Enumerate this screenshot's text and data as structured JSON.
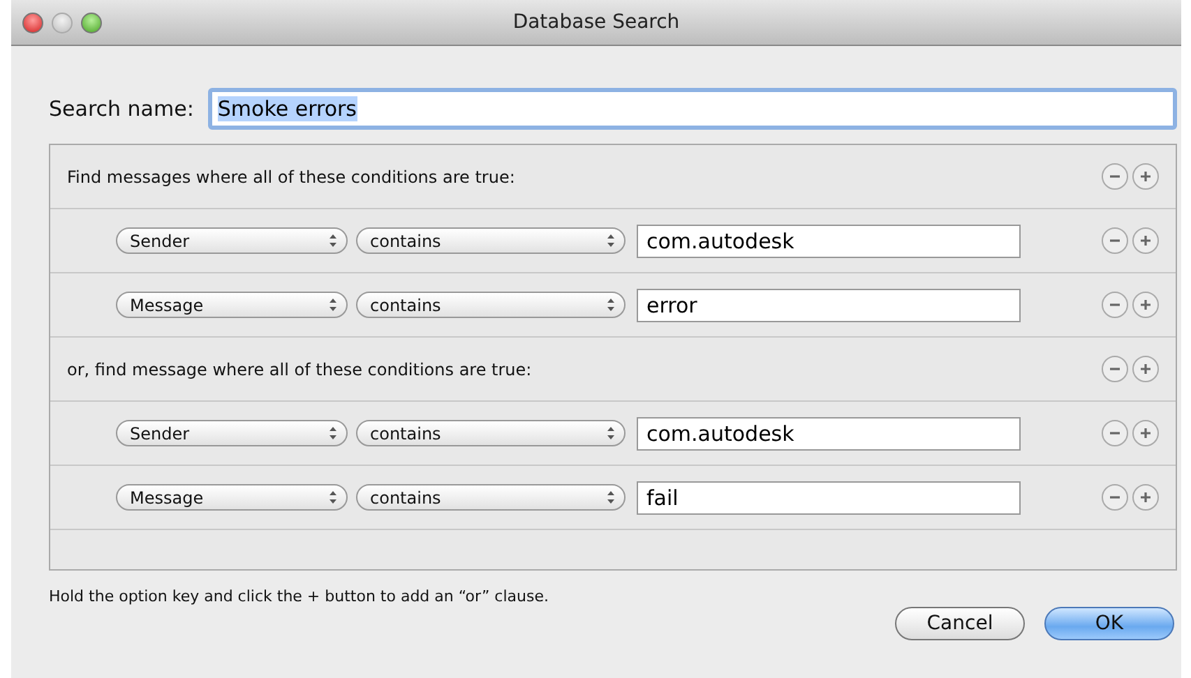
{
  "window": {
    "title": "Database Search"
  },
  "search_name": {
    "label": "Search name:",
    "value": "Smoke errors",
    "text_selected": true
  },
  "groups": [
    {
      "header": "Find messages where all of these conditions are true:",
      "conditions": [
        {
          "field": "Sender",
          "operator": "contains",
          "value": "com.autodesk"
        },
        {
          "field": "Message",
          "operator": "contains",
          "value": "error"
        }
      ]
    },
    {
      "header": "or, find message where all of these conditions are true:",
      "conditions": [
        {
          "field": "Sender",
          "operator": "contains",
          "value": "com.autodesk"
        },
        {
          "field": "Message",
          "operator": "contains",
          "value": "fail"
        }
      ]
    }
  ],
  "hint": "Hold the option key and click the + button to add an “or” clause.",
  "buttons": [
    {
      "label": "Cancel",
      "default": false
    },
    {
      "label": "OK",
      "default": true
    }
  ]
}
